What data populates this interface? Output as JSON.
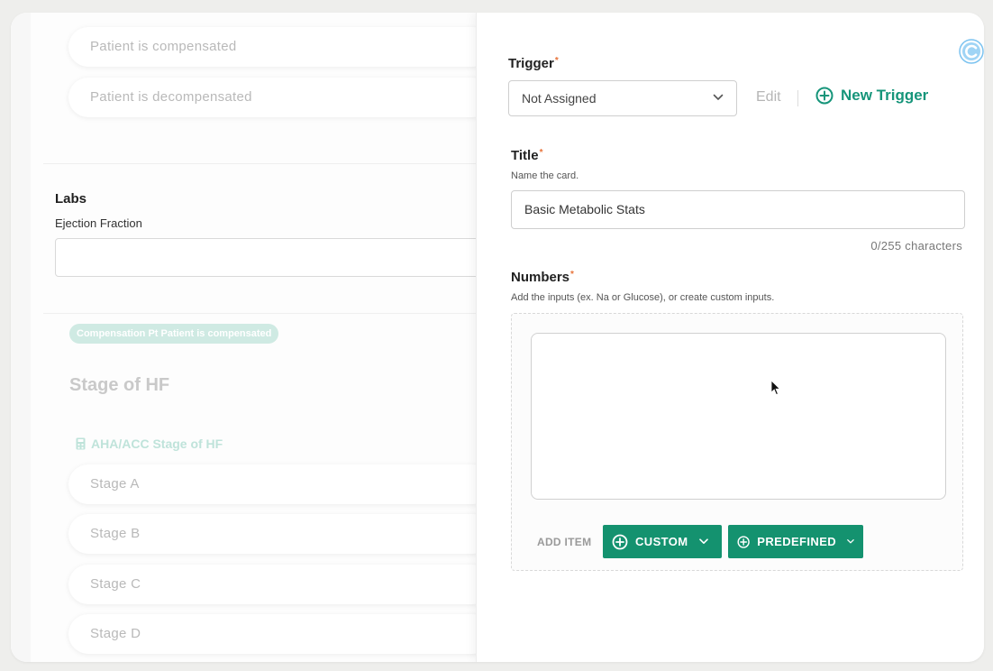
{
  "left_panel": {
    "options_top": [
      "Patient is compensated",
      "Patient is decompensated"
    ],
    "labs": {
      "title": "Labs",
      "field_label": "Ejection Fraction",
      "field_value": ""
    },
    "compensation_badge": "Compensation Pt Patient is compensated",
    "stage_heading": "Stage of HF",
    "calculator_link": "AHA/ACC Stage of HF",
    "stages": [
      "Stage A",
      "Stage B",
      "Stage C",
      "Stage D"
    ]
  },
  "drawer": {
    "trigger": {
      "label": "Trigger",
      "required_mark": "*",
      "selected": "Not Assigned",
      "edit_label": "Edit",
      "new_trigger_label": "New Trigger"
    },
    "title_field": {
      "label": "Title",
      "required_mark": "*",
      "help": "Name the card.",
      "value": "Basic Metabolic Stats",
      "char_count": "0/255 characters"
    },
    "numbers": {
      "label": "Numbers",
      "required_mark": "*",
      "help": "Add the inputs (ex. Na or Glucose), or create custom inputs.",
      "add_item_label": "ADD ITEM",
      "custom_button": "CUSTOM",
      "predefined_button": "PREDEFINED"
    }
  },
  "colors": {
    "accent": "#14926f",
    "required": "#e8743b",
    "badge_bg": "#cfeae3"
  },
  "icons": {
    "new_trigger": "plus-circle-icon",
    "dropdown": "chevron-down-icon",
    "calculator": "calculator-icon",
    "logo": "app-logo-icon"
  }
}
